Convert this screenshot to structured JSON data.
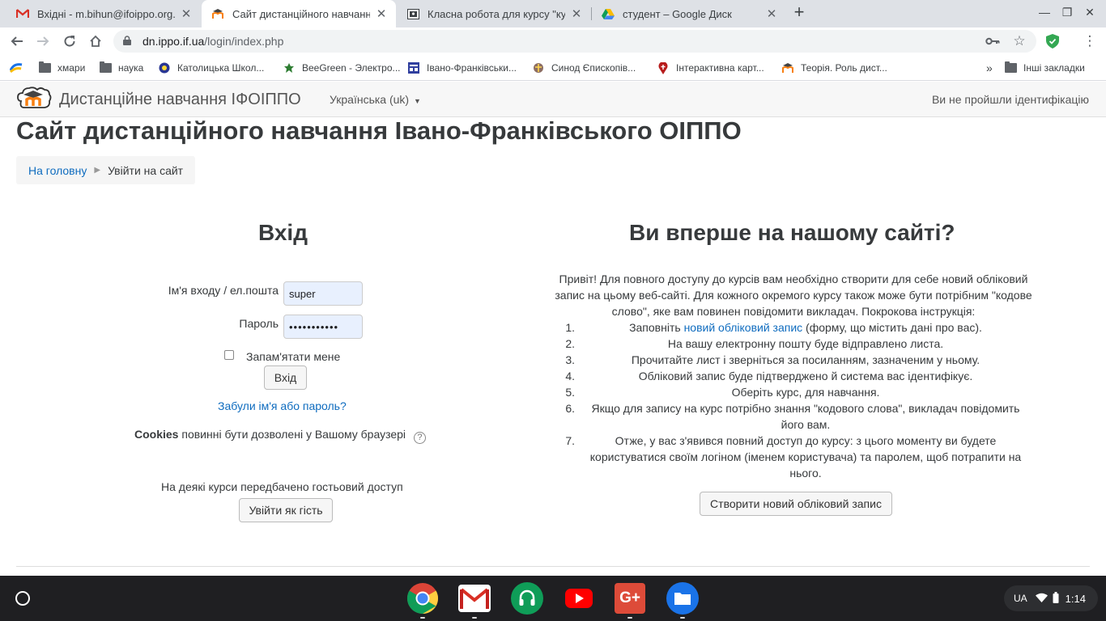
{
  "browser": {
    "tabs": [
      {
        "title": "Вхідні - m.bihun@ifoippo.org.ua",
        "icon": "gmail-icon"
      },
      {
        "title": "Сайт дистанційного навчання",
        "icon": "moodle-icon"
      },
      {
        "title": "Класна робота для курсу \"курс",
        "icon": "classroom-icon"
      },
      {
        "title": "студент – Google Диск",
        "icon": "google-drive-icon"
      }
    ],
    "url_host": "dn.ippo.if.ua",
    "url_path": "/login/index.php"
  },
  "bookmarks": [
    {
      "label": "",
      "icon": "bookmark-logo-icon"
    },
    {
      "label": "хмари",
      "icon": "folder-icon"
    },
    {
      "label": "наука",
      "icon": "folder-icon"
    },
    {
      "label": "Католицька Школ...",
      "icon": "school-icon"
    },
    {
      "label": "BeeGreen - Электро...",
      "icon": "beegreen-icon"
    },
    {
      "label": "Івано-Франківськи...",
      "icon": "site-icon"
    },
    {
      "label": "Синод Єпископів...",
      "icon": "synod-icon"
    },
    {
      "label": "Інтерактивна карт...",
      "icon": "map-pin-icon"
    },
    {
      "label": "Теорія. Роль дист...",
      "icon": "moodle-icon"
    }
  ],
  "bookmarks_more": "»",
  "bookmarks_other": "Інші закладки",
  "moodle": {
    "site_name": "Дистанційне навчання ІФОІППО",
    "language": "Українська (uk)",
    "not_logged_in": "Ви не пройшли ідентифікацію"
  },
  "page": {
    "title": "Сайт дистанційного навчання Івано-Франківського ОІППО",
    "breadcrumb": {
      "home": "На головну",
      "current": "Увійти на сайт"
    }
  },
  "login": {
    "heading": "Вхід",
    "username_label": "Ім'я входу / ел.пошта",
    "username_value": "super",
    "password_label": "Пароль",
    "password_value": "•••••••••••",
    "remember_label": "Запам'ятати мене",
    "submit": "Вхід",
    "forgot": "Забули ім'я або пароль?",
    "cookies_bold": "Cookies",
    "cookies_text": "повинні бути дозволені у Вашому браузері",
    "guest_text": "На деякі курси передбачено гостьовий доступ",
    "guest_button": "Увійти як гість"
  },
  "signup": {
    "heading": "Ви вперше на нашому сайті?",
    "intro": "Привіт! Для повного доступу до курсів вам необхідно створити для себе новий обліковий запис на цьому веб-сайті. Для кожного окремого курсу також може бути потрібним \"кодове слово\", яке вам повинен повідомити викладач. Покрокова інструкція:",
    "step1_pre": "Заповніть",
    "step1_link": "новий обліковий запис",
    "step1_post": "(форму, що містить дані про вас).",
    "steps": [
      "На вашу електронну пошту буде відправлено листа.",
      "Прочитайте лист і зверніться за посиланням, зазначеним у ньому.",
      "Обліковий запис буде підтверджено й система вас ідентифікує.",
      "Оберіть курс, для навчання.",
      "Якщо для запису на курс потрібно знання \"кодового слова\", викладач повідомить його вам.",
      "Отже, у вас з'явився повний доступ до курсу: з цього моменту ви будете користуватися своїм логіном (іменем користувача) та паролем, щоб потрапити на нього."
    ],
    "button": "Створити новий обліковий запис"
  },
  "shelf": {
    "apps": [
      "chrome-icon",
      "gmail-icon",
      "hangouts-icon",
      "youtube-icon",
      "google-plus-icon",
      "files-icon"
    ],
    "input_method": "UA",
    "time": "1:14"
  },
  "colors": {
    "link": "#0f6cbf",
    "moodle_orange": "#f98012",
    "shelf": "#1f1f22"
  }
}
